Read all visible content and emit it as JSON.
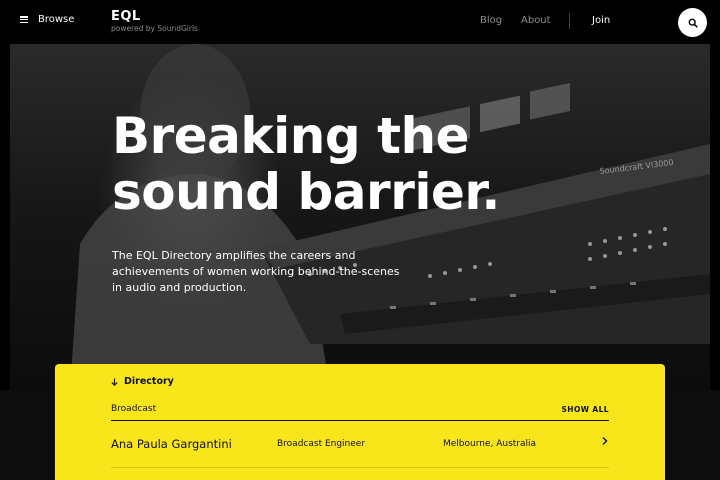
{
  "nav": {
    "menu_label": "Browse",
    "brand_title": "EQL",
    "brand_subtitle": "powered by SoundGirls",
    "links": [
      "Blog",
      "About"
    ],
    "join_label": "Join",
    "search_icon": "search-icon"
  },
  "hero": {
    "headline_line1": "Breaking the",
    "headline_line2": "sound barrier.",
    "intro": "The EQL Directory amplifies the careers and achievements of women working behind-the-scenes in audio and production.",
    "console_brand": "Soundcraft VI3000"
  },
  "directory": {
    "label": "Directory",
    "category": "Broadcast",
    "show_all": "SHOW ALL",
    "entries": [
      {
        "name": "Ana Paula Gargantini",
        "role": "Broadcast Engineer",
        "location": "Melbourne, Australia"
      }
    ]
  },
  "colors": {
    "accent_yellow": "#f9e61a",
    "background": "#000000",
    "nav_muted": "#8c8c8c"
  }
}
